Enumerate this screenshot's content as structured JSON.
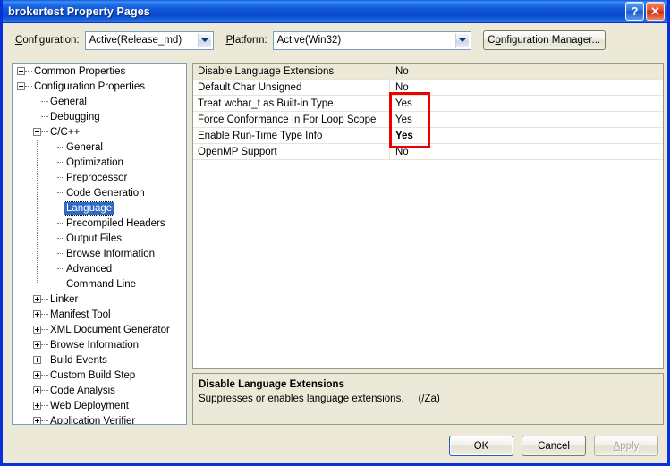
{
  "window": {
    "title": "brokertest Property Pages",
    "help_button": "?",
    "close_button": "✕"
  },
  "config_bar": {
    "configuration_label": "Configuration:",
    "configuration_value": "Active(Release_md)",
    "platform_label": "Platform:",
    "platform_value": "Active(Win32)",
    "configuration_manager_button": "Configuration Manager..."
  },
  "tree": {
    "items": [
      {
        "label": "Common Properties",
        "depth": 0,
        "expander": "plus",
        "selected": false
      },
      {
        "label": "Configuration Properties",
        "depth": 0,
        "expander": "minus",
        "selected": false
      },
      {
        "label": "General",
        "depth": 1,
        "expander": "none",
        "selected": false
      },
      {
        "label": "Debugging",
        "depth": 1,
        "expander": "none",
        "selected": false
      },
      {
        "label": "C/C++",
        "depth": 1,
        "expander": "minus",
        "selected": false
      },
      {
        "label": "General",
        "depth": 2,
        "expander": "none",
        "selected": false
      },
      {
        "label": "Optimization",
        "depth": 2,
        "expander": "none",
        "selected": false
      },
      {
        "label": "Preprocessor",
        "depth": 2,
        "expander": "none",
        "selected": false
      },
      {
        "label": "Code Generation",
        "depth": 2,
        "expander": "none",
        "selected": false
      },
      {
        "label": "Language",
        "depth": 2,
        "expander": "none",
        "selected": true
      },
      {
        "label": "Precompiled Headers",
        "depth": 2,
        "expander": "none",
        "selected": false
      },
      {
        "label": "Output Files",
        "depth": 2,
        "expander": "none",
        "selected": false
      },
      {
        "label": "Browse Information",
        "depth": 2,
        "expander": "none",
        "selected": false
      },
      {
        "label": "Advanced",
        "depth": 2,
        "expander": "none",
        "selected": false
      },
      {
        "label": "Command Line",
        "depth": 2,
        "expander": "none",
        "selected": false
      },
      {
        "label": "Linker",
        "depth": 1,
        "expander": "plus",
        "selected": false
      },
      {
        "label": "Manifest Tool",
        "depth": 1,
        "expander": "plus",
        "selected": false
      },
      {
        "label": "XML Document Generator",
        "depth": 1,
        "expander": "plus",
        "selected": false
      },
      {
        "label": "Browse Information",
        "depth": 1,
        "expander": "plus",
        "selected": false
      },
      {
        "label": "Build Events",
        "depth": 1,
        "expander": "plus",
        "selected": false
      },
      {
        "label": "Custom Build Step",
        "depth": 1,
        "expander": "plus",
        "selected": false
      },
      {
        "label": "Code Analysis",
        "depth": 1,
        "expander": "plus",
        "selected": false
      },
      {
        "label": "Web Deployment",
        "depth": 1,
        "expander": "plus",
        "selected": false
      },
      {
        "label": "Application Verifier",
        "depth": 1,
        "expander": "plus",
        "selected": false
      }
    ]
  },
  "properties": {
    "rows": [
      {
        "name": "Disable Language Extensions",
        "value": "No",
        "selected": true,
        "bold": false
      },
      {
        "name": "Default Char Unsigned",
        "value": "No",
        "selected": false,
        "bold": false
      },
      {
        "name": "Treat wchar_t as Built-in Type",
        "value": "Yes",
        "selected": false,
        "bold": false
      },
      {
        "name": "Force Conformance In For Loop Scope",
        "value": "Yes",
        "selected": false,
        "bold": false
      },
      {
        "name": "Enable Run-Time Type Info",
        "value": "Yes",
        "selected": false,
        "bold": true
      },
      {
        "name": "OpenMP Support",
        "value": "No",
        "selected": false,
        "bold": false
      }
    ]
  },
  "annotation": {
    "color": "#ee0000",
    "shape": "rectangle"
  },
  "description": {
    "title": "Disable Language Extensions",
    "body": "Suppresses or enables language extensions.     (/Za)"
  },
  "buttons": {
    "ok": "OK",
    "cancel": "Cancel",
    "apply": "Apply"
  }
}
